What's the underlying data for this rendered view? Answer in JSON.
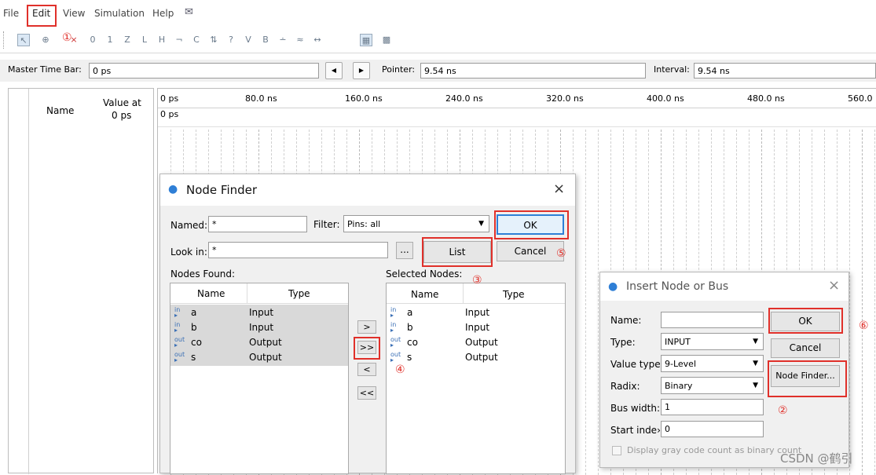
{
  "menu": {
    "file": "File",
    "edit": "Edit",
    "view": "View",
    "simulation": "Simulation",
    "help": "Help"
  },
  "toolbar_icons": [
    "pointer-tool-icon",
    "zoom-tool-icon",
    "forcing-icon",
    "low-icon",
    "high-icon",
    "z-icon",
    "weak-low-icon",
    "weak-high-icon",
    "invert-icon",
    "count-icon",
    "clock-icon",
    "random-icon",
    "value-icon",
    "arbitrary-icon",
    "snap-icon",
    "snap-grid-icon",
    "align-icon",
    "group-icon",
    "grid-icon"
  ],
  "timebar": {
    "master_label": "Master Time Bar:",
    "master_value": "0 ps",
    "pointer_label": "Pointer:",
    "pointer_value": "9.54 ns",
    "interval_label": "Interval:",
    "interval_value": "9.54 ns"
  },
  "signal_panel": {
    "name_header": "Name",
    "value_header": "Value at",
    "value_sub": "0 ps"
  },
  "wave": {
    "ticks": [
      "0 ps",
      "80.0 ns",
      "160.0 ns",
      "240.0 ns",
      "320.0 ns",
      "400.0 ns",
      "480.0 ns",
      "560.0"
    ],
    "cursor_label": "0 ps"
  },
  "node_finder": {
    "title": "Node Finder",
    "named_label": "Named:",
    "named_value": "*",
    "filter_label": "Filter:",
    "filter_value": "Pins: all",
    "lookin_label": "Look in:",
    "lookin_value": "*",
    "browse": "...",
    "list_button": "List",
    "ok_button": "OK",
    "cancel_button": "Cancel",
    "nodes_found_label": "Nodes Found:",
    "selected_nodes_label": "Selected Nodes:",
    "col_name": "Name",
    "col_type": "Type",
    "found": [
      {
        "dir": "in",
        "name": "a",
        "type": "Input"
      },
      {
        "dir": "in",
        "name": "b",
        "type": "Input"
      },
      {
        "dir": "out",
        "name": "co",
        "type": "Output"
      },
      {
        "dir": "out",
        "name": "s",
        "type": "Output"
      }
    ],
    "selected": [
      {
        "dir": "in",
        "name": "a",
        "type": "Input"
      },
      {
        "dir": "in",
        "name": "b",
        "type": "Input"
      },
      {
        "dir": "out",
        "name": "co",
        "type": "Output"
      },
      {
        "dir": "out",
        "name": "s",
        "type": "Output"
      }
    ],
    "move_buttons": [
      ">",
      ">>",
      "<",
      "<<"
    ]
  },
  "insert_node": {
    "title": "Insert Node or Bus",
    "name_label": "Name:",
    "name_value": "",
    "type_label": "Type:",
    "type_value": "INPUT",
    "value_type_label": "Value type",
    "value_type_value": "9-Level",
    "radix_label": "Radix:",
    "radix_value": "Binary",
    "bus_width_label": "Bus width:",
    "bus_width_value": "1",
    "start_index_label": "Start inde›",
    "start_index_value": "0",
    "gray_label": "Display gray code count as binary count",
    "ok_button": "OK",
    "cancel_button": "Cancel",
    "node_finder_button": "Node Finder..."
  },
  "annotations": [
    "①",
    "②",
    "③",
    "④",
    "⑤",
    "⑥"
  ],
  "watermark": "CSDN @鹤引",
  "colors": {
    "annotation_red": "#e0302a",
    "focus_blue": "#2f7fd6",
    "window_bg": "#f0f0f0"
  }
}
